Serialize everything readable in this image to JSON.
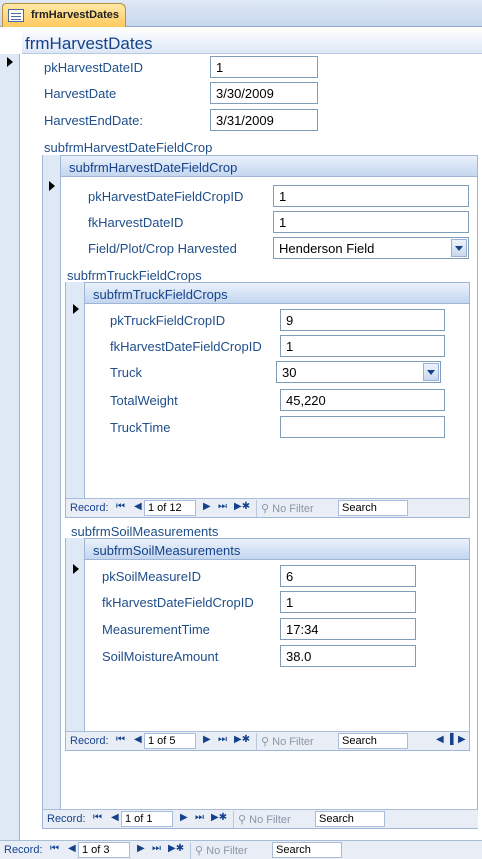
{
  "tab": {
    "label": "frmHarvestDates",
    "icon": "form-icon"
  },
  "form": {
    "title": "frmHarvestDates",
    "fields": {
      "id_label": "pkHarvestDateID",
      "id_value": "1",
      "date_label": "HarvestDate",
      "date_value": "3/30/2009",
      "end_label": "HarvestEndDate:",
      "end_value": "3/31/2009"
    }
  },
  "sub1": {
    "caption": "subfrmHarvestDateFieldCrop",
    "header": "subfrmHarvestDateFieldCrop",
    "fields": {
      "id_label": "pkHarvestDateFieldCropID",
      "id_value": "1",
      "fk_label": "fkHarvestDateID",
      "fk_value": "1",
      "field_label": "Field/Plot/Crop Harvested",
      "field_value": "Henderson Field"
    }
  },
  "sub2": {
    "caption": "subfrmTruckFieldCrops",
    "header": "subfrmTruckFieldCrops",
    "fields": {
      "id_label": "pkTruckFieldCropID",
      "id_value": "9",
      "fk_label": "fkHarvestDateFieldCropID",
      "fk_value": "1",
      "truck_label": "Truck",
      "truck_value": "30",
      "weight_label": "TotalWeight",
      "weight_value": "45,220",
      "time_label": "TruckTime",
      "time_value": ""
    },
    "nav": {
      "record_label": "Record:",
      "record_value": "1 of 12",
      "nofilter": "No Filter",
      "search": "Search"
    }
  },
  "sub3": {
    "caption": "subfrmSoilMeasurements",
    "header": "subfrmSoilMeasurements",
    "fields": {
      "id_label": "pkSoilMeasureID",
      "id_value": "6",
      "fk_label": "fkHarvestDateFieldCropID",
      "fk_value": "1",
      "time_label": "MeasurementTime",
      "time_value": "17:34",
      "moisture_label": "SoilMoistureAmount",
      "moisture_value": "38.0"
    },
    "nav": {
      "record_label": "Record:",
      "record_value": "1 of 5",
      "nofilter": "No Filter",
      "search": "Search"
    }
  },
  "sub1nav": {
    "record_label": "Record:",
    "record_value": "1 of 1",
    "nofilter": "No Filter",
    "search": "Search"
  },
  "mainnav": {
    "record_label": "Record:",
    "record_value": "1 of 3",
    "nofilter": "No Filter",
    "search": "Search"
  },
  "nav_glyphs": {
    "first": "⏮",
    "prev": "◀",
    "next": "▶",
    "last": "⏭",
    "new": "▶✱",
    "filter": "⚲"
  }
}
